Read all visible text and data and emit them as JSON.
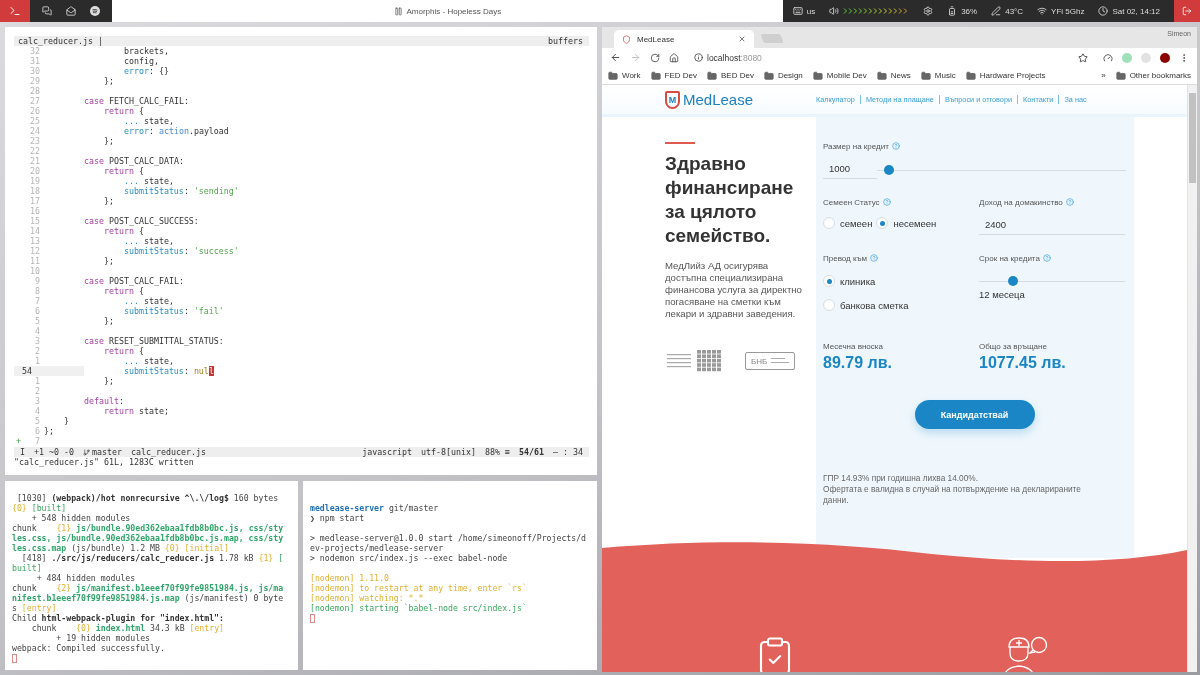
{
  "topbar": {
    "title": "Amorphis - Hopeless Days",
    "keyboard": "us",
    "battery": "36%",
    "temperature": "43°C",
    "wifi": "YFi 5Ghz",
    "clock": "Sat 02, 14:12"
  },
  "editor": {
    "tab": "calc_reducer.js |",
    "buffers": "buffers",
    "lines": [
      {
        "n": "32",
        "current": false,
        "s": [
          {
            "kind": "plain",
            "t": "                brackets,"
          }
        ]
      },
      {
        "n": "31",
        "current": false,
        "s": [
          {
            "kind": "plain",
            "t": "                config,"
          }
        ]
      },
      {
        "n": "30",
        "current": false,
        "s": [
          {
            "kind": "prop",
            "t": "                error"
          },
          {
            "kind": "plain",
            "t": ": {}"
          }
        ]
      },
      {
        "n": "29",
        "current": false,
        "s": [
          {
            "kind": "plain",
            "t": "            };"
          }
        ]
      },
      {
        "n": "28",
        "current": false
      },
      {
        "n": "27",
        "current": false,
        "s": [
          {
            "kind": "keyword",
            "t": "        case"
          },
          {
            "kind": "plain",
            "t": " FETCH_CALC_FAIL:"
          }
        ]
      },
      {
        "n": "26",
        "current": false,
        "s": [
          {
            "kind": "keyword",
            "t": "            return"
          },
          {
            "kind": "plain",
            "t": " {"
          }
        ]
      },
      {
        "n": "25",
        "current": false,
        "s": [
          {
            "kind": "prop",
            "t": "                ..."
          },
          {
            "kind": "plain",
            "t": " state,"
          }
        ]
      },
      {
        "n": "24",
        "current": false,
        "s": [
          {
            "kind": "prop",
            "t": "                error"
          },
          {
            "kind": "plain",
            "t": ": "
          },
          {
            "kind": "builtin",
            "t": "action"
          },
          {
            "kind": "plain",
            "t": ".payload"
          }
        ]
      },
      {
        "n": "23",
        "current": false,
        "s": [
          {
            "kind": "plain",
            "t": "            };"
          }
        ]
      },
      {
        "n": "22",
        "current": false
      },
      {
        "n": "21",
        "current": false,
        "s": [
          {
            "kind": "keyword",
            "t": "        case"
          },
          {
            "kind": "plain",
            "t": " POST_CALC_DATA:"
          }
        ]
      },
      {
        "n": "20",
        "current": false,
        "s": [
          {
            "kind": "keyword",
            "t": "            return"
          },
          {
            "kind": "plain",
            "t": " {"
          }
        ]
      },
      {
        "n": "19",
        "current": false,
        "s": [
          {
            "kind": "prop",
            "t": "                ..."
          },
          {
            "kind": "plain",
            "t": " state,"
          }
        ]
      },
      {
        "n": "18",
        "current": false,
        "s": [
          {
            "kind": "prop",
            "t": "                submitStatus"
          },
          {
            "kind": "plain",
            "t": ": "
          },
          {
            "kind": "string",
            "t": "'sending'"
          }
        ]
      },
      {
        "n": "17",
        "current": false,
        "s": [
          {
            "kind": "plain",
            "t": "            };"
          }
        ]
      },
      {
        "n": "16",
        "current": false
      },
      {
        "n": "15",
        "current": false,
        "s": [
          {
            "kind": "keyword",
            "t": "        case"
          },
          {
            "kind": "plain",
            "t": " POST_CALC_SUCCESS:"
          }
        ]
      },
      {
        "n": "14",
        "current": false,
        "s": [
          {
            "kind": "keyword",
            "t": "            return"
          },
          {
            "kind": "plain",
            "t": " {"
          }
        ]
      },
      {
        "n": "13",
        "current": false,
        "s": [
          {
            "kind": "prop",
            "t": "                ..."
          },
          {
            "kind": "plain",
            "t": " state,"
          }
        ]
      },
      {
        "n": "12",
        "current": false,
        "s": [
          {
            "kind": "prop",
            "t": "                submitStatus"
          },
          {
            "kind": "plain",
            "t": ": "
          },
          {
            "kind": "string",
            "t": "'success'"
          }
        ]
      },
      {
        "n": "11",
        "current": false,
        "s": [
          {
            "kind": "plain",
            "t": "            };"
          }
        ]
      },
      {
        "n": "10",
        "current": false
      },
      {
        "n": "9",
        "current": false,
        "s": [
          {
            "kind": "keyword",
            "t": "        case"
          },
          {
            "kind": "plain",
            "t": " POST_CALC_FAIL:"
          }
        ]
      },
      {
        "n": "8",
        "current": false,
        "s": [
          {
            "kind": "keyword",
            "t": "            return"
          },
          {
            "kind": "plain",
            "t": " {"
          }
        ]
      },
      {
        "n": "7",
        "current": false,
        "s": [
          {
            "kind": "prop",
            "t": "                ..."
          },
          {
            "kind": "plain",
            "t": " state,"
          }
        ]
      },
      {
        "n": "6",
        "current": false,
        "s": [
          {
            "kind": "prop",
            "t": "                submitStatus"
          },
          {
            "kind": "plain",
            "t": ": "
          },
          {
            "kind": "string",
            "t": "'fail'"
          }
        ]
      },
      {
        "n": "5",
        "current": false,
        "s": [
          {
            "kind": "plain",
            "t": "            };"
          }
        ]
      },
      {
        "n": "4",
        "current": false
      },
      {
        "n": "3",
        "current": false,
        "s": [
          {
            "kind": "keyword",
            "t": "        case"
          },
          {
            "kind": "plain",
            "t": " RESET_SUBMITTAL_STATUS:"
          }
        ]
      },
      {
        "n": "2",
        "current": false,
        "s": [
          {
            "kind": "keyword",
            "t": "            return"
          },
          {
            "kind": "plain",
            "t": " {"
          }
        ]
      },
      {
        "n": "1",
        "current": false,
        "s": [
          {
            "kind": "prop",
            "t": "                ..."
          },
          {
            "kind": "plain",
            "t": " state,"
          }
        ]
      },
      {
        "n": "54",
        "current": true,
        "s": [
          {
            "kind": "prop",
            "t": "                submitStatus"
          },
          {
            "kind": "plain",
            "t": ": "
          },
          {
            "kind": "null",
            "t": "nul"
          },
          {
            "kind": "cursor",
            "t": "l"
          }
        ]
      },
      {
        "n": "1",
        "current": false,
        "s": [
          {
            "kind": "plain",
            "t": "            };"
          }
        ]
      },
      {
        "n": "2",
        "current": false
      },
      {
        "n": "3",
        "current": false,
        "s": [
          {
            "kind": "keyword",
            "t": "        default"
          },
          {
            "kind": "plain",
            "t": ":"
          }
        ]
      },
      {
        "n": "4",
        "current": false,
        "s": [
          {
            "kind": "keyword",
            "t": "            return"
          },
          {
            "kind": "plain",
            "t": " state;"
          }
        ]
      },
      {
        "n": "5",
        "current": false,
        "s": [
          {
            "kind": "plain",
            "t": "    }"
          }
        ]
      },
      {
        "n": "6",
        "current": false,
        "s": [
          {
            "kind": "plain",
            "t": "};"
          }
        ]
      },
      {
        "n": "7",
        "current": false,
        "sign": "+"
      }
    ],
    "status": {
      "mode": "I",
      "changes": "+1 ~0 -0",
      "branch": "master",
      "file": "calc_reducer.js",
      "filetype": "javascript",
      "encoding": "utf-8[unix]",
      "percent": "88% ≡",
      "position": "54/61",
      "column": "— : 34"
    },
    "message": "\"calc_reducer.js\" 61L, 1283C written"
  },
  "terminal_left": [
    [
      {
        "kind": "plain",
        "t": " [1030] "
      },
      {
        "kind": "bold",
        "t": "(webpack)/hot nonrecursive ^\\.\\/log$"
      },
      {
        "kind": "plain",
        "t": " 160 bytes"
      }
    ],
    [
      {
        "kind": "number",
        "t": "{0}"
      },
      {
        "kind": "ok",
        "t": " [built]"
      }
    ],
    [
      {
        "kind": "plain",
        "t": "    + 548 hidden modules"
      }
    ],
    [
      {
        "kind": "plain",
        "t": "chunk    "
      },
      {
        "kind": "number",
        "t": "{1}"
      },
      {
        "kind": "path",
        "t": " js/bundle.90ed362ebaa1fdb8b0bc.js, css/sty"
      }
    ],
    [
      {
        "kind": "path",
        "t": "les.css, js/bundle.90ed362ebaa1fdb8b0bc.js.map, css/sty"
      }
    ],
    [
      {
        "kind": "path",
        "t": "les.css.map"
      },
      {
        "kind": "plain",
        "t": " (js/bundle) 1.2 MB "
      },
      {
        "kind": "number",
        "t": "{0}"
      },
      {
        "kind": "number",
        "t": " [initial]"
      }
    ],
    [
      {
        "kind": "plain",
        "t": "  [418] "
      },
      {
        "kind": "bold",
        "t": "./src/js/reducers/calc_reducer.js"
      },
      {
        "kind": "plain",
        "t": " 1.78 kB "
      },
      {
        "kind": "number",
        "t": "{1}"
      },
      {
        "kind": "ok",
        "t": " ["
      }
    ],
    [
      {
        "kind": "ok",
        "t": "built]"
      }
    ],
    [
      {
        "kind": "plain",
        "t": "     + 484 hidden modules"
      }
    ],
    [
      {
        "kind": "plain",
        "t": "chunk    "
      },
      {
        "kind": "number",
        "t": "{2}"
      },
      {
        "kind": "path",
        "t": " js/manifest.b1eeef70f99fe9851984.js, js/ma"
      }
    ],
    [
      {
        "kind": "path",
        "t": "nifest.b1eeef70f99fe9851984.js.map"
      },
      {
        "kind": "plain",
        "t": " (js/manifest) 0 byte"
      }
    ],
    [
      {
        "kind": "plain",
        "t": "s "
      },
      {
        "kind": "number",
        "t": "[entry]"
      }
    ],
    [
      {
        "kind": "plain",
        "t": "Child "
      },
      {
        "kind": "bold",
        "t": "html-webpack-plugin for \"index.html\":"
      }
    ],
    [
      {
        "kind": "plain",
        "t": "    chunk    "
      },
      {
        "kind": "number",
        "t": "{0}"
      },
      {
        "kind": "path",
        "t": " index.html"
      },
      {
        "kind": "plain",
        "t": " 34.3 kB "
      },
      {
        "kind": "number",
        "t": "[entry]"
      }
    ],
    [
      {
        "kind": "plain",
        "t": "         + 19 hidden modules"
      }
    ],
    [
      {
        "kind": "plain",
        "t": "webpack: Compiled successfully."
      }
    ]
  ],
  "terminal_right": [
    [
      [
        {
          "kind": "dir",
          "t": "medlease-server"
        },
        {
          "kind": "plain",
          "t": " git/master"
        }
      ],
      [
        {
          "kind": "plain",
          "t": "❯ npm start"
        }
      ]
    ],
    [
      [
        {
          "kind": "plain",
          "t": "> medlease-server@1.0.0 start /home/simeonoff/Projects/d"
        }
      ],
      [
        {
          "kind": "plain",
          "t": "ev-projects/medlease-server"
        }
      ],
      [
        {
          "kind": "plain",
          "t": "> nodemon src/index.js --exec babel-node"
        }
      ]
    ],
    [
      [
        {
          "kind": "number",
          "t": "[nodemon] 1.11.0"
        }
      ],
      [
        {
          "kind": "number",
          "t": "[nodemon] to restart at any time, enter `rs`"
        }
      ],
      [
        {
          "kind": "number",
          "t": "[nodemon] watching: *.*"
        }
      ],
      [
        {
          "kind": "ok",
          "t": "[nodemon] starting `babel-node src/index.js`"
        }
      ]
    ]
  ],
  "browser": {
    "profile": "Simeon",
    "tab": "MedLease",
    "forward_disabled": true,
    "url": {
      "host": "localhost",
      "port": ":8080"
    },
    "bookmarks": [
      "Work",
      "FED Dev",
      "BED Dev",
      "Design",
      "Mobile Dev",
      "News",
      "Music",
      "Hardware Projects"
    ],
    "bookmarks_more": "»",
    "other_bookmarks": "Other bookmarks"
  },
  "page": {
    "logo_mark": "M",
    "brand": "MedLease",
    "nav": [
      "Калкулатор",
      "Методи на плащане",
      "Въпроси и отговори",
      "Контакти",
      "За нас"
    ],
    "heading": "Здравно финансиране за цялото семейство.",
    "intro": "МедЛийз АД осигурява достъпна специализирана финансова услуга за директно погасяване на сметки към лекари и здравни заведения.",
    "badge": "БНБ",
    "form": {
      "amount": {
        "label": "Размер на кредит",
        "value": "1000",
        "level": 0.05
      },
      "status": {
        "label": "Семеен Статус",
        "options": [
          {
            "label": "семеен",
            "selected": false
          },
          {
            "label": "несемеен",
            "selected": true
          }
        ]
      },
      "income": {
        "label": "Доход на домакинство",
        "value": "2400"
      },
      "transfer": {
        "label": "Превод към",
        "options": [
          {
            "label": "клиника",
            "selected": true
          },
          {
            "label": "банкова сметка",
            "selected": false
          }
        ]
      },
      "term": {
        "label": "Срок на кредита",
        "level": 0.23,
        "reading": "12 месеца"
      },
      "results": [
        {
          "label": "Месечна вноска",
          "value": "89.79 лв."
        },
        {
          "label": "Общо за връщане",
          "value": "1077.45 лв."
        }
      ],
      "submit": "Кандидатствай",
      "notes": [
        "ГПР 14.93% при годишна лихва 14.00%.",
        "Офертата е валидна в случай на потвърждение на декларираните данни."
      ]
    }
  }
}
